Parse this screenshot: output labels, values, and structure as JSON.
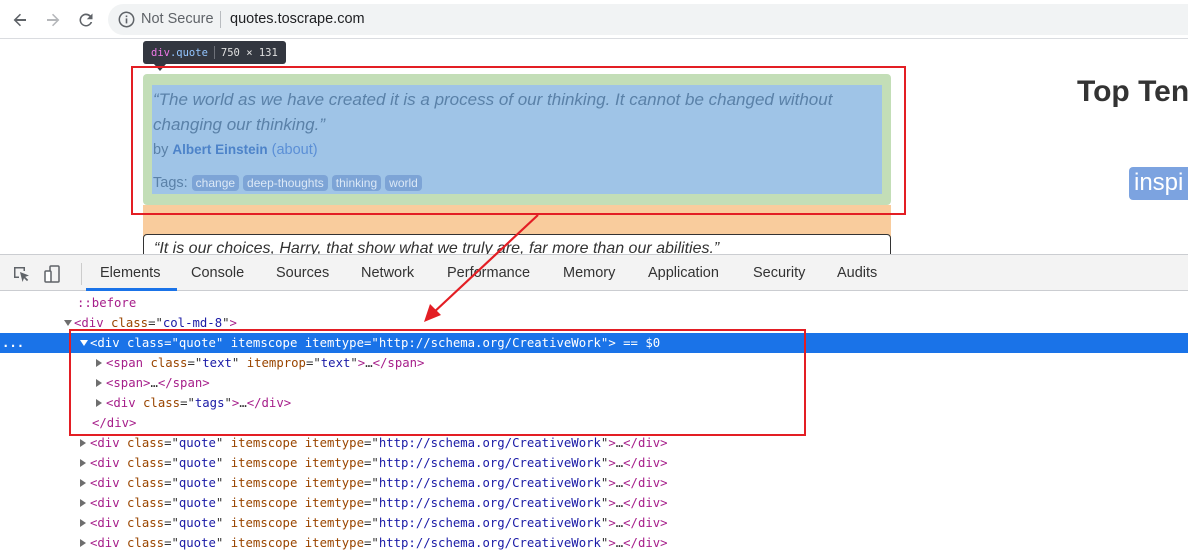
{
  "browser": {
    "not_secure_label": "Not Secure",
    "url": "quotes.toscrape.com"
  },
  "page": {
    "tooltip": {
      "tag": "div",
      "class": ".quote",
      "dims": "750 × 131"
    },
    "quote": {
      "text": "“The world as we have created it is a process of our thinking. It cannot be changed without changing our thinking.”",
      "by_label": "by",
      "author": "Albert Einstein",
      "about": "(about)",
      "tags_label": "Tags:",
      "tags": [
        "change",
        "deep-thoughts",
        "thinking",
        "world"
      ]
    },
    "second_quote_text": "“It is our choices, Harry, that show what we truly are, far more than our abilities.”",
    "sidebar_title": "Top Ten",
    "sidebar_tag": "inspi"
  },
  "devtools": {
    "tabs": [
      "Elements",
      "Console",
      "Sources",
      "Network",
      "Performance",
      "Memory",
      "Application",
      "Security",
      "Audits"
    ],
    "active_tab": "Elements",
    "tree": {
      "before": "::before",
      "col_open": {
        "tag": "div",
        "attr": "class",
        "value": "col-md-8"
      },
      "selected": {
        "tag": "div",
        "class_value": "quote",
        "itemscope": "itemscope",
        "itemtype_value": "http://schema.org/CreativeWork",
        "marker": "== $0"
      },
      "span_text": {
        "tag": "span",
        "class_value": "text",
        "itemprop_value": "text"
      },
      "span_plain": "span",
      "tags_div": {
        "tag": "div",
        "class_value": "tags"
      },
      "close_div": "</div>",
      "ellipsis": "…",
      "collapsed_quote_count": 6
    }
  }
}
